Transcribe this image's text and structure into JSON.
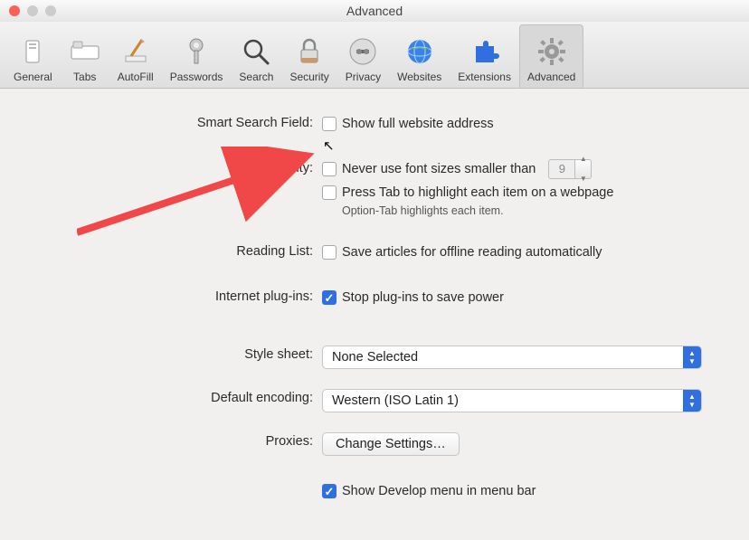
{
  "window": {
    "title": "Advanced"
  },
  "toolbar": [
    {
      "label": "General"
    },
    {
      "label": "Tabs"
    },
    {
      "label": "AutoFill"
    },
    {
      "label": "Passwords"
    },
    {
      "label": "Search"
    },
    {
      "label": "Security"
    },
    {
      "label": "Privacy"
    },
    {
      "label": "Websites"
    },
    {
      "label": "Extensions"
    },
    {
      "label": "Advanced"
    }
  ],
  "labels": {
    "smart_search": "Smart Search Field:",
    "accessibility": "Accessibility:",
    "reading_list": "Reading List:",
    "plugins": "Internet plug-ins:",
    "stylesheet": "Style sheet:",
    "encoding": "Default encoding:",
    "proxies": "Proxies:"
  },
  "options": {
    "show_full_address": "Show full website address",
    "never_font_smaller": "Never use font sizes smaller than",
    "font_size_value": "9",
    "press_tab": "Press Tab to highlight each item on a webpage",
    "press_tab_hint": "Option-Tab highlights each item.",
    "save_offline": "Save articles for offline reading automatically",
    "stop_plugins": "Stop plug-ins to save power",
    "stylesheet_value": "None Selected",
    "encoding_value": "Western (ISO Latin 1)",
    "proxies_button": "Change Settings…",
    "show_develop": "Show Develop menu in menu bar"
  },
  "checked": {
    "show_full_address": false,
    "never_font_smaller": false,
    "press_tab": false,
    "save_offline": false,
    "stop_plugins": true,
    "show_develop": true
  }
}
